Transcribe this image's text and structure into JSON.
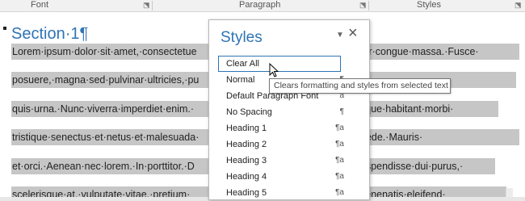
{
  "ribbon": {
    "font_label": "Font",
    "paragraph_label": "Paragraph",
    "styles_label": "Styles"
  },
  "document": {
    "heading": "Section·1¶",
    "lines": [
      "Lorem·ipsum·dolor·sit·amet,·consectetue",
      "posuere,·magna·sed·pulvinar·ultricies,·pu",
      "quis·urna.·Nunc·viverra·imperdiet·enim.·",
      "tristique·senectus·et·netus·et·malesuada·",
      "et·orci.·Aenean·nec·lorem.·In·porttitor.·D",
      "scelerisque·at,·vulputate·vitae,·pretium·"
    ],
    "lines_right": [
      "tor·congue·massa.·Fusce·",
      "",
      "sque·habitant·morbi·",
      "pede.·Mauris·",
      "uspendisse·dui·purus,·",
      "venenatis·eleifend·"
    ]
  },
  "styles_pane": {
    "title": "Styles",
    "menu_icon": "dropdown-arrow-icon",
    "close_icon": "close-icon",
    "items": [
      {
        "label": "Clear All",
        "glyph": ""
      },
      {
        "label": "Normal",
        "glyph": "¶"
      },
      {
        "label": "Default Paragraph Font",
        "glyph": "a"
      },
      {
        "label": "No Spacing",
        "glyph": "¶"
      },
      {
        "label": "Heading 1",
        "glyph": "¶a"
      },
      {
        "label": "Heading 2",
        "glyph": "¶a"
      },
      {
        "label": "Heading 3",
        "glyph": "¶a"
      },
      {
        "label": "Heading 4",
        "glyph": "¶a"
      },
      {
        "label": "Heading 5",
        "glyph": "¶a"
      }
    ]
  },
  "tooltip": {
    "text": "Clears formatting and styles from selected text"
  },
  "colors": {
    "accent": "#2e74b5",
    "selection": "#c6c6c6"
  }
}
